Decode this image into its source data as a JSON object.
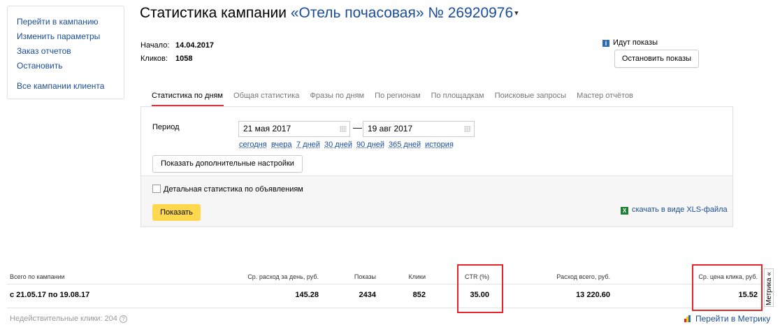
{
  "sidebar": {
    "items": [
      "Перейти в кампанию",
      "Изменить параметры",
      "Заказ отчетов",
      "Остановить"
    ],
    "all_campaigns": "Все кампании клиента"
  },
  "header": {
    "title_prefix": "Статистика кампании",
    "campaign": "«Отель почасовая» № 26920976",
    "caret": "▾"
  },
  "meta": {
    "start_label": "Начало:",
    "start_value": "14.04.2017",
    "clicks_label": "Кликов:",
    "clicks_value": "1058"
  },
  "status": {
    "text": "Идут показы",
    "info_icon": "i",
    "stop_button": "Остановить показы"
  },
  "tabs": [
    "Статистика по дням",
    "Общая статистика",
    "Фразы по дням",
    "По регионам",
    "По площадкам",
    "Поисковые запросы",
    "Мастер отчётов"
  ],
  "filter": {
    "period_label": "Период",
    "date_from": "21 мая 2017",
    "dash": "—",
    "date_to": "19 авг 2017",
    "quick_links": [
      "сегодня",
      "вчера",
      "7 дней",
      "30 дней",
      "90 дней",
      "365 дней",
      "история"
    ],
    "advanced_button": "Показать дополнительные настройки",
    "detailed_checkbox": "Детальная статистика по объявлениям",
    "detailed_checked": false,
    "show_button": "Показать",
    "xls_link": "скачать в виде XLS-файла",
    "xls_icon": "X"
  },
  "stats": {
    "headers": [
      "Всего по кампании",
      "Ср. расход за день, руб.",
      "Показы",
      "Клики",
      "CTR (%)",
      "Расход всего, руб.",
      "Ср. цена клика, руб."
    ],
    "row": [
      "с 21.05.17 по 19.08.17",
      "145.28",
      "2434",
      "852",
      "35.00",
      "13 220.60",
      "15.52"
    ],
    "highlight_color": "#e8242b"
  },
  "metrika_tab": "Метрика «",
  "invalid_clicks": "Недействительные клики: 204",
  "q_icon": "?",
  "metrika_link": "Перейти в Метрику",
  "colors": {
    "link": "#1a4d99",
    "accent_button": "#ffd84e",
    "tab_underline": "#d6343f"
  }
}
